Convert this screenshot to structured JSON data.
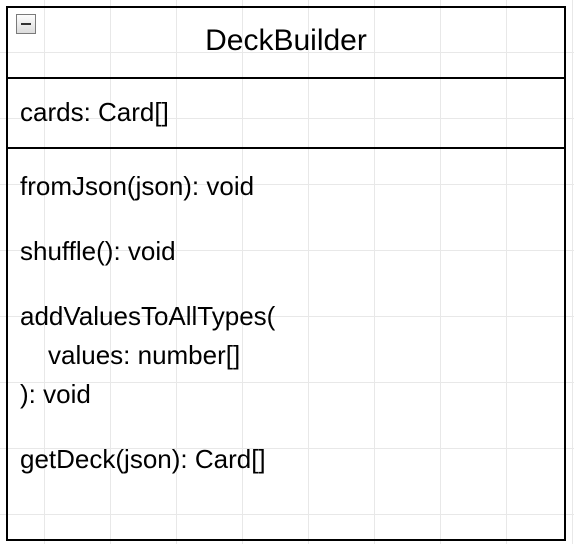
{
  "class": {
    "name": "DeckBuilder",
    "attributes": [
      {
        "signature": "cards: Card[]"
      }
    ],
    "methods": [
      {
        "lines": [
          "fromJson(json): void"
        ]
      },
      {
        "lines": [
          "shuffle(): void"
        ]
      },
      {
        "lines": [
          "addValuesToAllTypes(",
          "  values: number[]",
          "): void"
        ]
      },
      {
        "lines": [
          "getDeck(json): Card[]"
        ]
      }
    ]
  },
  "icons": {
    "collapse": "minus-icon"
  }
}
